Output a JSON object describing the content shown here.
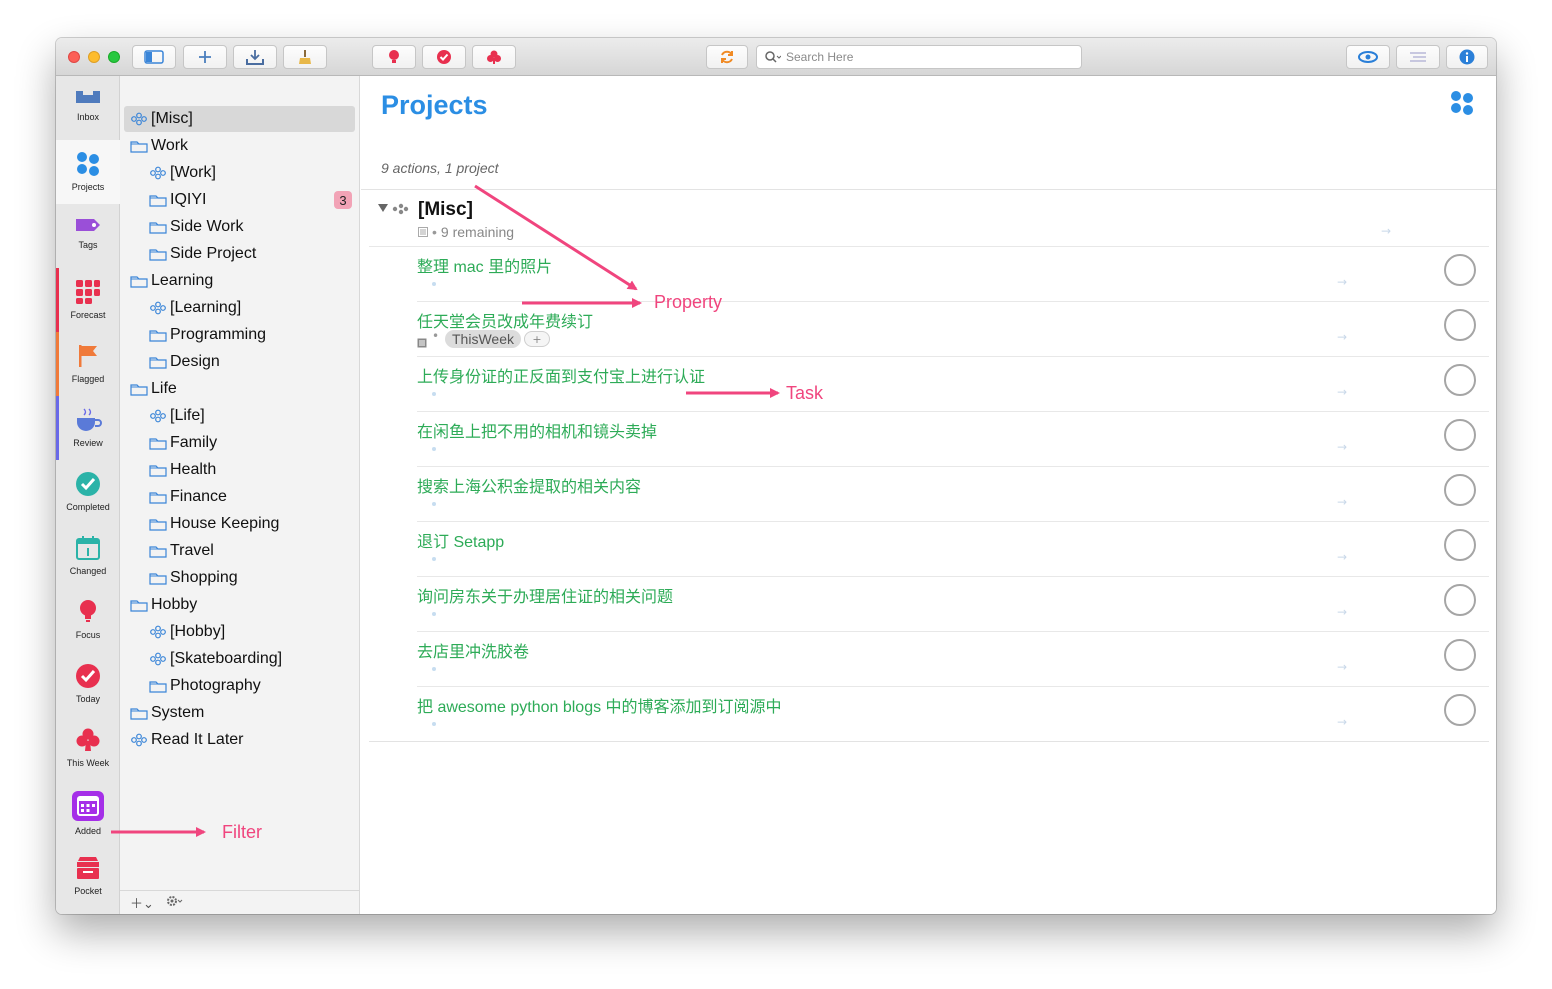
{
  "toolbar": {
    "search_placeholder": "Search Here"
  },
  "perspectives": [
    {
      "label": "Inbox",
      "icon": "inbox-icon"
    },
    {
      "label": "Projects",
      "icon": "projects-icon"
    },
    {
      "label": "Tags",
      "icon": "tag-icon"
    },
    {
      "label": "Forecast",
      "icon": "forecast-icon"
    },
    {
      "label": "Flagged",
      "icon": "flag-icon"
    },
    {
      "label": "Review",
      "icon": "coffee-cup-icon"
    },
    {
      "label": "Completed",
      "icon": "checkmark-circle-icon"
    },
    {
      "label": "Changed",
      "icon": "calendar-icon"
    },
    {
      "label": "Focus",
      "icon": "lightbulb-icon"
    },
    {
      "label": "Today",
      "icon": "today-check-icon"
    },
    {
      "label": "This Week",
      "icon": "club-icon"
    },
    {
      "label": "Added",
      "icon": "calendar-grid-icon"
    },
    {
      "label": "Pocket",
      "icon": "pocket-icon"
    }
  ],
  "sidebar": {
    "items": [
      {
        "label": "[Misc]",
        "type": "project"
      },
      {
        "label": "Work",
        "type": "folder"
      },
      {
        "label": "[Work]",
        "type": "project"
      },
      {
        "label": "IQIYI",
        "type": "folder",
        "badge": "3"
      },
      {
        "label": "Side Work",
        "type": "folder"
      },
      {
        "label": "Side Project",
        "type": "folder"
      },
      {
        "label": "Learning",
        "type": "folder"
      },
      {
        "label": "[Learning]",
        "type": "project"
      },
      {
        "label": "Programming",
        "type": "folder"
      },
      {
        "label": "Design",
        "type": "folder"
      },
      {
        "label": "Life",
        "type": "folder"
      },
      {
        "label": "[Life]",
        "type": "project"
      },
      {
        "label": "Family",
        "type": "folder"
      },
      {
        "label": "Health",
        "type": "folder"
      },
      {
        "label": "Finance",
        "type": "folder"
      },
      {
        "label": "House Keeping",
        "type": "folder"
      },
      {
        "label": "Travel",
        "type": "folder"
      },
      {
        "label": "Shopping",
        "type": "folder"
      },
      {
        "label": "Hobby",
        "type": "folder"
      },
      {
        "label": "[Hobby]",
        "type": "project"
      },
      {
        "label": "[Skateboarding]",
        "type": "project"
      },
      {
        "label": "Photography",
        "type": "folder"
      },
      {
        "label": "System",
        "type": "folder"
      },
      {
        "label": "Read It Later",
        "type": "project"
      }
    ]
  },
  "main": {
    "title": "Projects",
    "subtitle": "9 actions, 1 project",
    "project": {
      "title": "[Misc]",
      "remaining": "9 remaining"
    },
    "tasks": [
      {
        "title": "整理 mac 里的照片"
      },
      {
        "title": "任天堂会员改成年费续订",
        "tag": "ThisWeek"
      },
      {
        "title": "上传身份证的正反面到支付宝上进行认证"
      },
      {
        "title": "在闲鱼上把不用的相机和镜头卖掉"
      },
      {
        "title": "搜索上海公积金提取的相关内容"
      },
      {
        "title": "退订 Setapp"
      },
      {
        "title": "询问房东关于办理居住证的相关问题"
      },
      {
        "title": "去店里冲洗胶卷"
      },
      {
        "title": "把 awesome python blogs 中的博客添加到订阅源中"
      }
    ]
  },
  "annotations": {
    "property": "Property",
    "task": "Task",
    "filter": "Filter"
  },
  "colors": {
    "accent_blue": "#2b8ee4",
    "task_green": "#2dab57",
    "annotation_pink": "#f0457e",
    "badge_pink": "#f2a3b6"
  }
}
